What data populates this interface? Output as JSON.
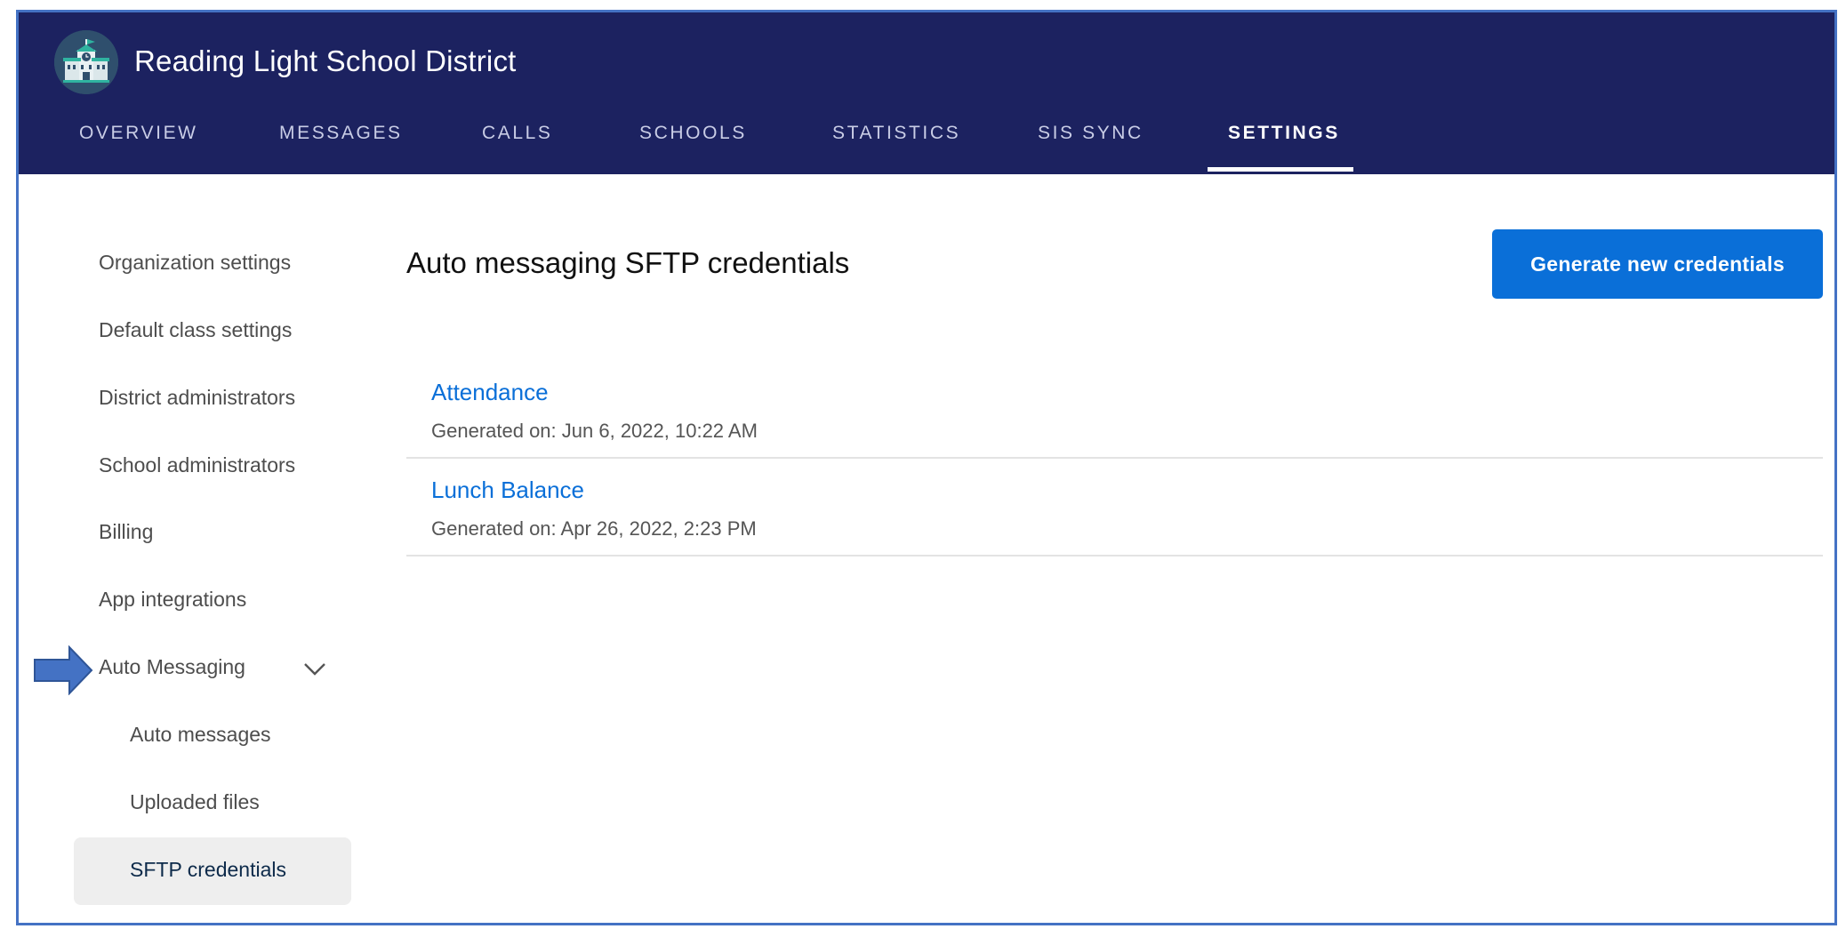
{
  "header": {
    "org_name": "Reading Light School District",
    "logo_icon": "school-building-icon",
    "tabs": [
      {
        "label": "OVERVIEW"
      },
      {
        "label": "MESSAGES"
      },
      {
        "label": "CALLS"
      },
      {
        "label": "SCHOOLS"
      },
      {
        "label": "STATISTICS"
      },
      {
        "label": "SIS SYNC"
      },
      {
        "label": "SETTINGS",
        "active": true
      }
    ],
    "background_color": "#1c2260"
  },
  "sidebar": {
    "items": [
      {
        "label": "Organization settings"
      },
      {
        "label": "Default class settings"
      },
      {
        "label": "District administrators"
      },
      {
        "label": "School administrators"
      },
      {
        "label": "Billing"
      },
      {
        "label": "App integrations"
      },
      {
        "label": "Auto Messaging",
        "expanded": true,
        "icon": "chevron-down-icon"
      }
    ],
    "subitems": [
      {
        "label": "Auto messages"
      },
      {
        "label": "Uploaded files"
      },
      {
        "label": "SFTP credentials",
        "selected": true
      }
    ],
    "pointer_icon": "blue-arrow-icon"
  },
  "main": {
    "title": "Auto messaging SFTP credentials",
    "generate_button_label": "Generate new credentials",
    "accent_color": "#0a6fd8",
    "credentials": [
      {
        "name": "Attendance",
        "generated": "Generated on: Jun 6, 2022, 10:22 AM"
      },
      {
        "name": "Lunch Balance",
        "generated": "Generated on: Apr 26, 2022, 2:23 PM"
      }
    ]
  }
}
